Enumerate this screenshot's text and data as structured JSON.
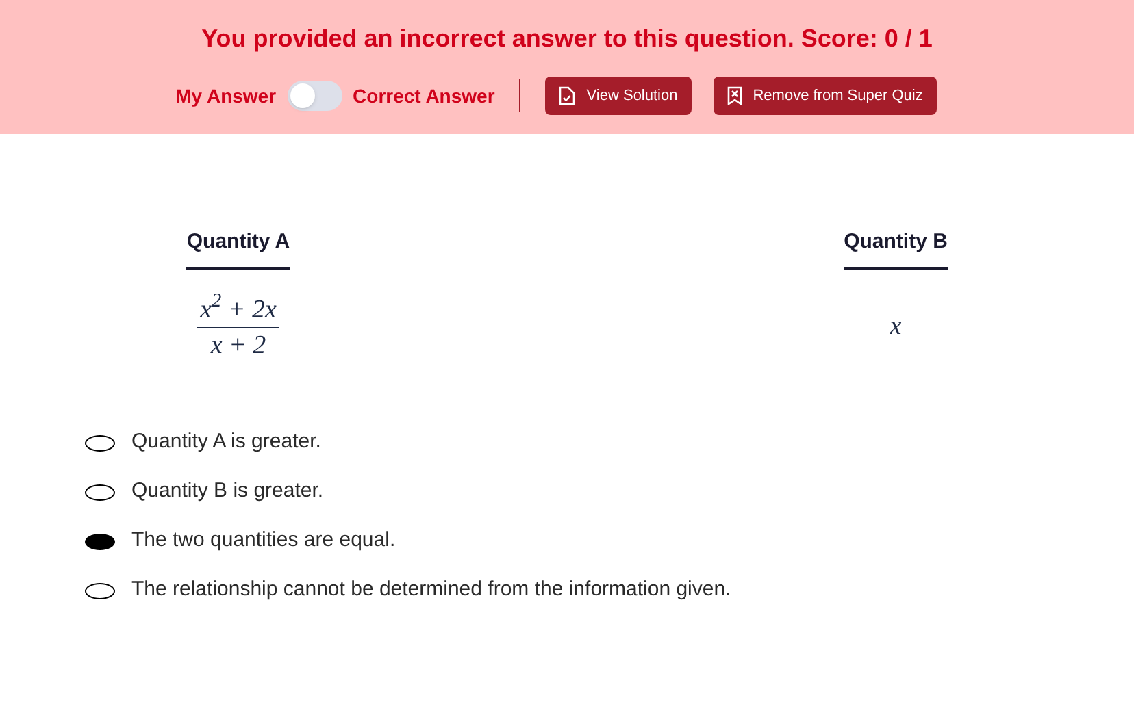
{
  "banner": {
    "message": "You provided an incorrect answer to this question. Score: 0 / 1",
    "toggle": {
      "left_label": "My Answer",
      "right_label": "Correct Answer",
      "on": false
    },
    "buttons": [
      {
        "kind": "solution",
        "label": "View Solution"
      },
      {
        "kind": "bookmark",
        "label": "Remove from Super Quiz"
      }
    ]
  },
  "quantities": [
    {
      "heading": "Quantity A",
      "kind": "fraction",
      "numerator": "x$^{2}$ + 2x",
      "denominator": "x + 2"
    },
    {
      "heading": "Quantity B",
      "kind": "plain",
      "value": "x"
    }
  ],
  "options": [
    {
      "label": "Quantity A is greater.",
      "selected": false
    },
    {
      "label": "Quantity B is greater.",
      "selected": false
    },
    {
      "label": "The two quantities are equal.",
      "selected": true
    },
    {
      "label": "The relationship cannot be determined from the information given.",
      "selected": false
    }
  ]
}
